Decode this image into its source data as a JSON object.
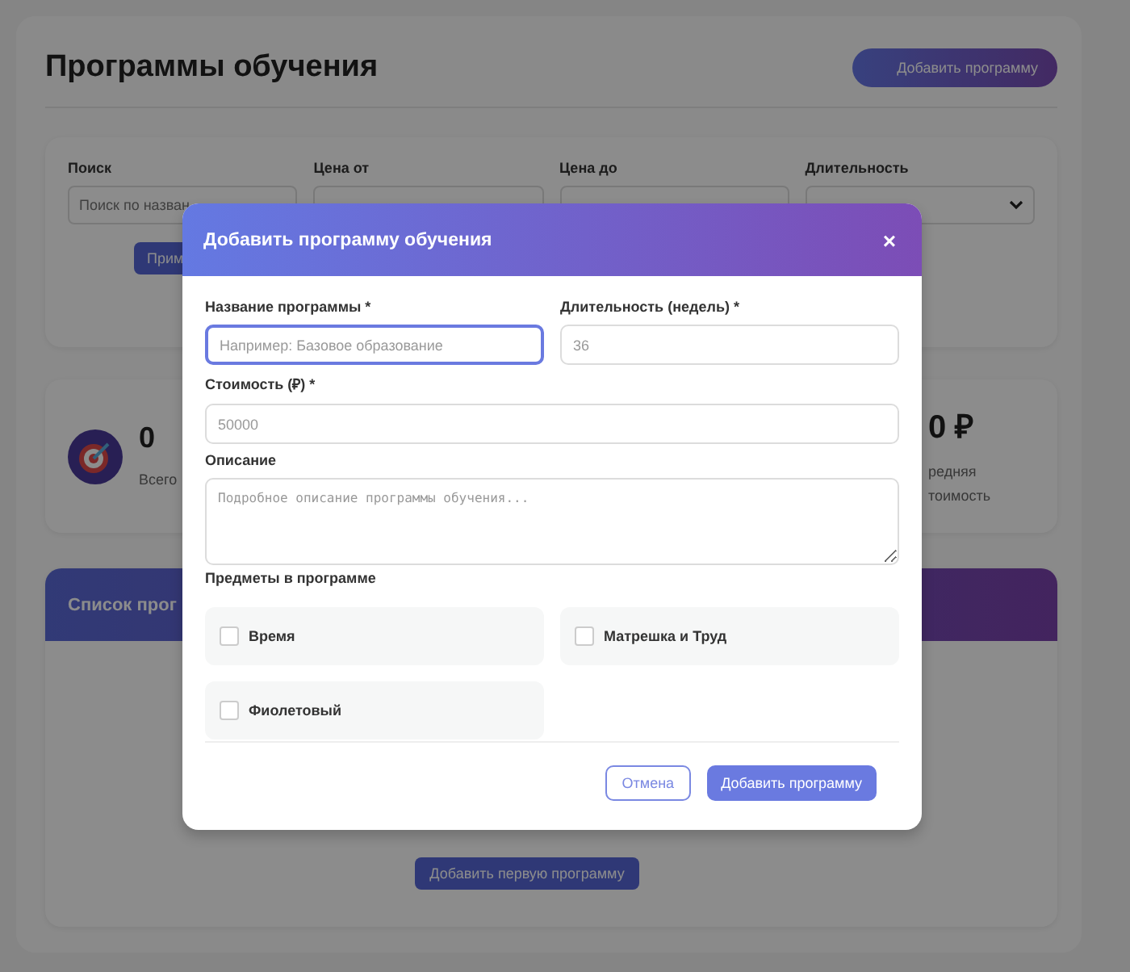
{
  "page": {
    "title": "Программы обучения",
    "add_button": "Добавить программу",
    "filters": [
      {
        "label": "Поиск",
        "kind": "input",
        "placeholder": "Поиск по назван"
      },
      {
        "label": "Цена от",
        "kind": "input"
      },
      {
        "label": "Цена до",
        "kind": "input"
      },
      {
        "label": "Длительность",
        "kind": "select"
      }
    ],
    "apply_button": "Прим",
    "stats": [
      {
        "value": "0",
        "lines": [
          "Всего"
        ]
      },
      {
        "value": "0 ₽",
        "lines": [
          "редняя",
          "тоимость"
        ]
      }
    ],
    "list": {
      "title": "Список прог",
      "empty_button": "Добавить первую программу"
    }
  },
  "dialog": {
    "title": "Добавить программу обучения",
    "close": "×",
    "fields": [
      {
        "label": "Название программы *",
        "kind": "input",
        "placeholder": "Например: Базовое образование",
        "focused": true,
        "half": true
      },
      {
        "label": "Длительность (недель) *",
        "kind": "input",
        "placeholder": "36",
        "focused": false,
        "half": true
      },
      {
        "label": "Стоимость (₽) *",
        "kind": "input",
        "placeholder": "50000",
        "focused": false,
        "half": false
      },
      {
        "label": "Описание",
        "kind": "textarea",
        "placeholder": "Подробное описание программы обучения...",
        "focused": false,
        "half": false
      }
    ],
    "subjects_label": "Предметы в программе",
    "subjects": [
      {
        "label": "Время",
        "checked": false
      },
      {
        "label": "Матрешка и Труд",
        "checked": false
      },
      {
        "label": "Фиолетовый",
        "checked": false
      }
    ],
    "cancel": "Отмена",
    "submit": "Добавить программу"
  }
}
